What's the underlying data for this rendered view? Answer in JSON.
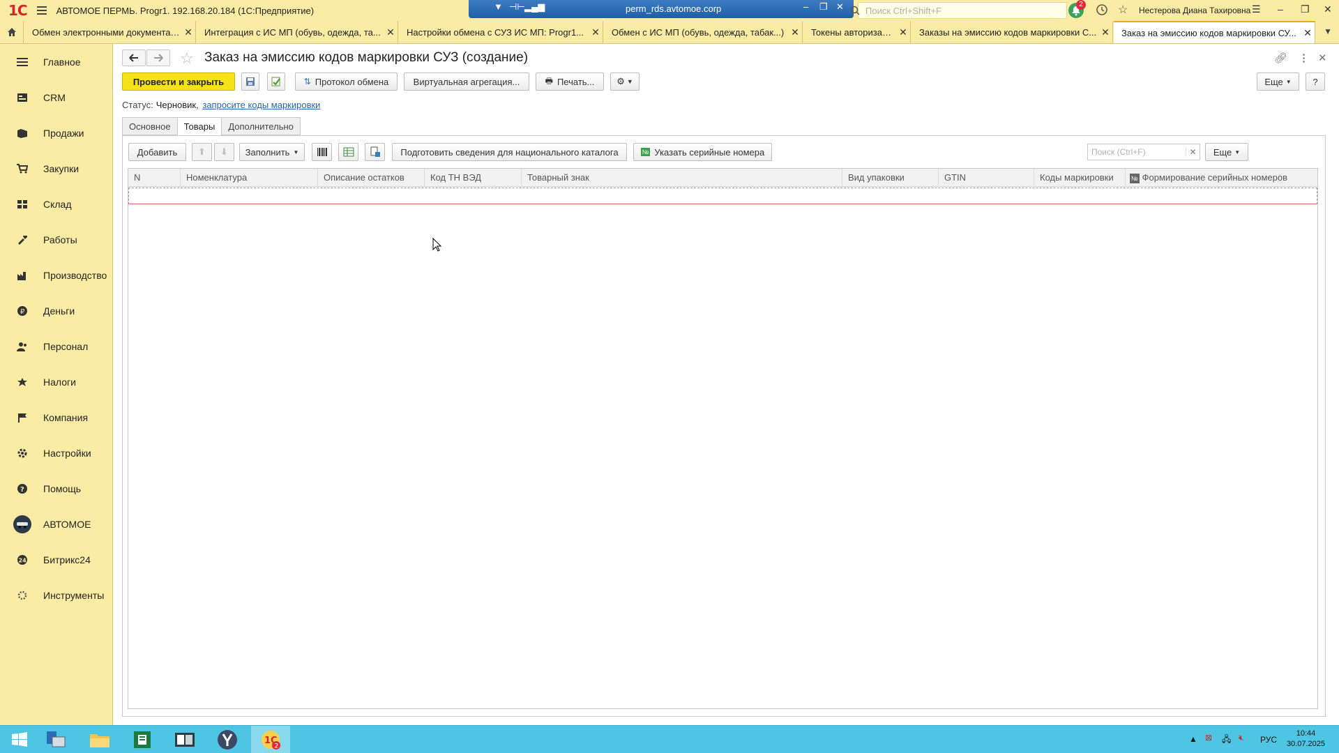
{
  "titlebar": {
    "logo": "1С",
    "app_title": "АВТОМОЕ ПЕРМЬ. Progr1. 192.168.20.184  (1С:Предприятие)",
    "rds_host": "perm_rds.avtomoe.corp",
    "search_placeholder": "Поиск Ctrl+Shift+F",
    "notifications_count": "2",
    "user_name": "Нестерова Диана Тахировна"
  },
  "open_tabs": [
    {
      "label": "Обмен электронными документами"
    },
    {
      "label": "Интеграция с ИС МП (обувь, одежда, та..."
    },
    {
      "label": "Настройки обмена с СУЗ ИС МП: Progr1..."
    },
    {
      "label": "Обмен с ИС МП (обувь, одежда, табак...)"
    },
    {
      "label": "Токены авторизации"
    },
    {
      "label": "Заказы на эмиссию кодов маркировки С..."
    },
    {
      "label": "Заказ на эмиссию кодов маркировки СУ..."
    }
  ],
  "sidebar": {
    "items": [
      {
        "label": "Главное",
        "icon": "menu-icon"
      },
      {
        "label": "CRM",
        "icon": "crm-icon"
      },
      {
        "label": "Продажи",
        "icon": "sales-icon"
      },
      {
        "label": "Закупки",
        "icon": "purchases-icon"
      },
      {
        "label": "Склад",
        "icon": "warehouse-icon"
      },
      {
        "label": "Работы",
        "icon": "works-icon"
      },
      {
        "label": "Производство",
        "icon": "production-icon"
      },
      {
        "label": "Деньги",
        "icon": "money-icon"
      },
      {
        "label": "Персонал",
        "icon": "personnel-icon"
      },
      {
        "label": "Налоги",
        "icon": "taxes-icon"
      },
      {
        "label": "Компания",
        "icon": "company-icon"
      },
      {
        "label": "Настройки",
        "icon": "settings-icon"
      },
      {
        "label": "Помощь",
        "icon": "help-icon"
      },
      {
        "label": "АВТОМОЕ",
        "icon": "avtomoe-icon"
      },
      {
        "label": "Битрикс24",
        "icon": "bitrix-icon"
      },
      {
        "label": "Инструменты",
        "icon": "tools-icon"
      }
    ]
  },
  "form": {
    "title": "Заказ на эмиссию кодов маркировки СУЗ (создание)",
    "toolbar": {
      "post_close": "Провести и закрыть",
      "protocol": "Протокол обмена",
      "virtual_aggregation": "Виртуальная агрегация...",
      "print": "Печать...",
      "more": "Еще",
      "help": "?"
    },
    "status_label": "Статус:",
    "status_value": "Черновик,",
    "status_link": "запросите коды маркировки",
    "tabs": [
      "Основное",
      "Товары",
      "Дополнительно"
    ],
    "goods_toolbar": {
      "add": "Добавить",
      "fill": "Заполнить",
      "prepare_catalog": "Подготовить сведения для национального каталога",
      "serial_numbers": "Указать серийные номера",
      "search_placeholder": "Поиск (Ctrl+F)",
      "more": "Еще"
    },
    "table": {
      "columns": [
        "N",
        "Номенклатура",
        "Описание остатков",
        "Код ТН ВЭД",
        "Товарный знак",
        "Вид упаковки",
        "GTIN",
        "Коды маркировки",
        "Формирование серийных номеров"
      ]
    }
  },
  "taskbar": {
    "lang": "РУС",
    "time": "10:44",
    "date": "30.07.2025"
  },
  "colors": {
    "panel_yellow": "#fbeca5",
    "primary_button": "#f7e21a",
    "link": "#2a64a8",
    "taskbar": "#4ec5e2"
  }
}
